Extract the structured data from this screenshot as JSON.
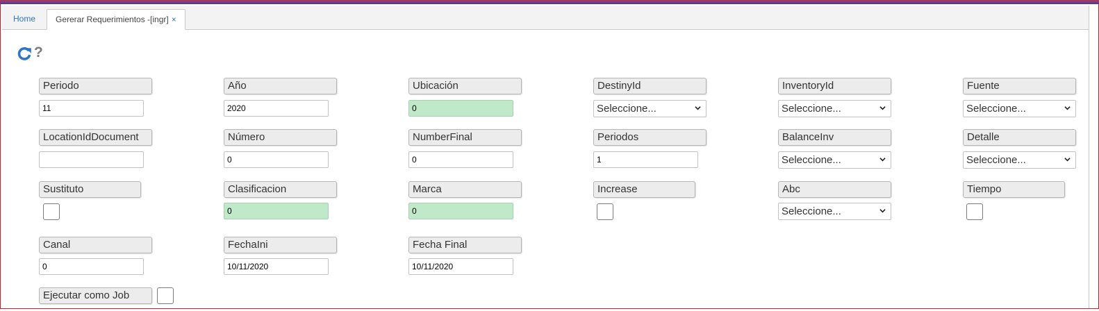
{
  "tabs": {
    "home": "Home",
    "active": "Gererar Requerimientos -[ingr]",
    "close_glyph": "×"
  },
  "toolbar": {
    "refresh_icon": "refresh-icon",
    "help_glyph": "?"
  },
  "form": {
    "periodo": {
      "label": "Periodo",
      "value": "11"
    },
    "anio": {
      "label": "Año",
      "value": "2020"
    },
    "ubicacion": {
      "label": "Ubicación",
      "value": "0"
    },
    "destinyid": {
      "label": "DestinyId",
      "value": "Seleccione..."
    },
    "inventoryid": {
      "label": "InventoryId",
      "value": "Seleccione..."
    },
    "fuente": {
      "label": "Fuente",
      "value": "Seleccione..."
    },
    "locationiddocument": {
      "label": "LocationIdDocument",
      "value": ""
    },
    "numero": {
      "label": "Número",
      "value": "0"
    },
    "numberfinal": {
      "label": "NumberFinal",
      "value": "0"
    },
    "periodos": {
      "label": "Periodos",
      "value": "1"
    },
    "balanceinv": {
      "label": "BalanceInv",
      "value": "Seleccione..."
    },
    "detalle": {
      "label": "Detalle",
      "value": "Seleccione..."
    },
    "sustituto": {
      "label": "Sustituto"
    },
    "clasificacion": {
      "label": "Clasificacion",
      "value": "0"
    },
    "marca": {
      "label": "Marca",
      "value": "0"
    },
    "increase": {
      "label": "Increase"
    },
    "abc": {
      "label": "Abc",
      "value": "Seleccione..."
    },
    "tiempo": {
      "label": "Tiempo"
    },
    "canal": {
      "label": "Canal",
      "value": "0"
    },
    "fechaini": {
      "label": "FechaIni",
      "value": "10/11/2020"
    },
    "fechafinal": {
      "label": "Fecha Final",
      "value": "10/11/2020"
    },
    "ejecutar": {
      "label": "Ejecutar como Job"
    }
  },
  "colors": {
    "accent": "#2e75c7",
    "readonly_field": "#bfe9c9",
    "label_bg": "#ececec",
    "frame_border": "#c0262a"
  }
}
